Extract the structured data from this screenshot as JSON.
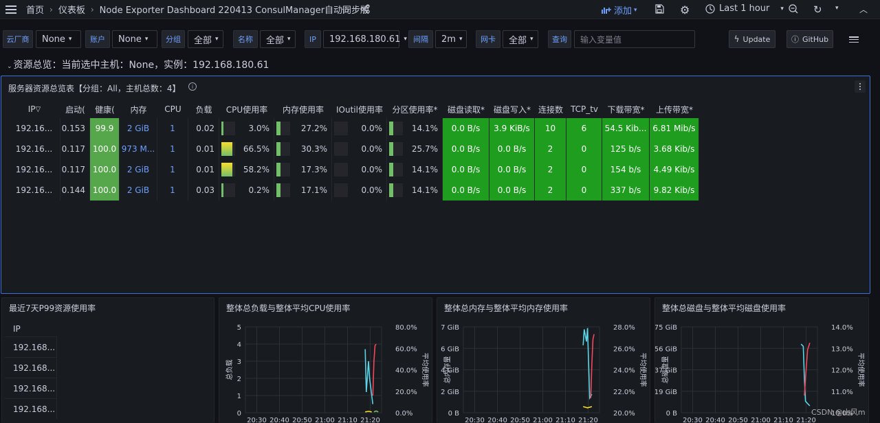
{
  "breadcrumb": {
    "home": "首页",
    "dashboards": "仪表板",
    "title": "Node Exporter Dashboard 220413 ConsulManager自动同步版"
  },
  "toolbar": {
    "add_label": "添加",
    "time_range": "Last 1 hour",
    "colors": {
      "add": "#6e9fff"
    }
  },
  "variables": {
    "cloud_label": "云厂商",
    "cloud_value": "None",
    "account_label": "账户",
    "account_value": "None",
    "group_label": "分组",
    "group_value": "全部",
    "name_label": "名称",
    "name_value": "全部",
    "ip_label": "IP",
    "ip_value": "192.168.180.61",
    "interval_label": "间隔",
    "interval_value": "2m",
    "nic_label": "网卡",
    "nic_value": "全部",
    "query_label": "查询",
    "query_placeholder": "输入变量值",
    "update_label": "Update",
    "github_label": "GitHub"
  },
  "row_title": "资源总览：当前选中主机：None，实例：192.168.180.61",
  "main_panel": {
    "title": "服务器资源总览表【分组：All，主机总数：4】",
    "columns": [
      "IP",
      "启动(",
      "健康(",
      "内存",
      "CPU",
      "负载",
      "CPU使用率",
      "内存使用率",
      "IOutil使用率",
      "分区使用率*",
      "磁盘读取*",
      "磁盘写入*",
      "连接数",
      "TCP_tv",
      "下载带宽*",
      "上传带宽*"
    ],
    "rows": [
      {
        "ip": "192.16...",
        "uptime": "0.153",
        "health": "99.9",
        "mem": "2 GiB",
        "cpu": "1",
        "load": "0.02",
        "cpu_pct": "3.0%",
        "cpu_level": 0.03,
        "mem_pct": "27.2%",
        "mem_level": 0.272,
        "io_pct": "0.0%",
        "io_level": 0.0,
        "part_pct": "14.1%",
        "part_level": 0.141,
        "disk_read": "0.0 B/s",
        "disk_write": "3.9 KiB/s",
        "conn": "10",
        "tcp_tw": "6",
        "down": "54.5 Kib...",
        "up": "6.81 Mib/s"
      },
      {
        "ip": "192.16...",
        "uptime": "0.117",
        "health": "100.0",
        "mem": "973 M...",
        "cpu": "1",
        "load": "0.01",
        "cpu_pct": "66.5%",
        "cpu_level": 0.665,
        "mem_pct": "30.3%",
        "mem_level": 0.303,
        "io_pct": "0.0%",
        "io_level": 0.0,
        "part_pct": "25.7%",
        "part_level": 0.257,
        "disk_read": "0.0 B/s",
        "disk_write": "0.0 B/s",
        "conn": "2",
        "tcp_tw": "0",
        "down": "125 b/s",
        "up": "3.68 Kib/s"
      },
      {
        "ip": "192.16...",
        "uptime": "0.117",
        "health": "100.0",
        "mem": "2 GiB",
        "cpu": "1",
        "load": "0.01",
        "cpu_pct": "58.2%",
        "cpu_level": 0.582,
        "mem_pct": "17.3%",
        "mem_level": 0.173,
        "io_pct": "0.0%",
        "io_level": 0.0,
        "part_pct": "14.1%",
        "part_level": 0.141,
        "disk_read": "0.0 B/s",
        "disk_write": "0.0 B/s",
        "conn": "2",
        "tcp_tw": "0",
        "down": "154 b/s",
        "up": "4.49 Kib/s"
      },
      {
        "ip": "192.16...",
        "uptime": "0.144",
        "health": "100.0",
        "mem": "2 GiB",
        "cpu": "1",
        "load": "0.03",
        "cpu_pct": "0.2%",
        "cpu_level": 0.002,
        "mem_pct": "17.1%",
        "mem_level": 0.171,
        "io_pct": "0.0%",
        "io_level": 0.0,
        "part_pct": "14.1%",
        "part_level": 0.141,
        "disk_read": "0.0 B/s",
        "disk_write": "0.0 B/s",
        "conn": "2",
        "tcp_tw": "0",
        "down": "337 b/s",
        "up": "9.82 Kib/s"
      }
    ]
  },
  "p99_panel": {
    "title": "最近7天P99资源使用率",
    "column": "IP",
    "rows": [
      "192.168...",
      "192.168...",
      "192.168...",
      "192.168..."
    ]
  },
  "chart_data": [
    {
      "type": "line",
      "title": "整体总负载与整体平均CPU使用率",
      "ylabel_left": "总负载",
      "ylabel_right": "平均使用率",
      "x_ticks": [
        "20:30",
        "20:40",
        "20:50",
        "21:00",
        "21:10",
        "21:20"
      ],
      "y_left_ticks": [
        "0",
        "1",
        "2",
        "3",
        "4",
        "5"
      ],
      "y_right_ticks": [
        "0.0%",
        "20.0%",
        "40.0%",
        "60.0%",
        "80.0%"
      ],
      "ylim_left": [
        0,
        5
      ],
      "ylim_right": [
        0,
        80
      ],
      "series": [
        {
          "color": "#73bf69",
          "x": [
            21.38,
            21.4,
            21.42
          ],
          "y": [
            0.05,
            0.1,
            0.05
          ]
        },
        {
          "color": "#5ad4e6",
          "x": [
            21.3,
            21.31,
            21.33,
            21.34,
            21.36,
            21.37
          ],
          "y": [
            3.7,
            1.2,
            3.0,
            2.0,
            1.0,
            0.5
          ]
        },
        {
          "color": "#f2495c",
          "x": [
            21.37,
            21.38,
            21.39,
            21.4
          ],
          "y": [
            1.0,
            3.0,
            3.9,
            4.0
          ]
        },
        {
          "color": "#fade2a",
          "x": [
            21.3,
            21.33,
            21.36
          ],
          "y": [
            0.05,
            0.08,
            0.05
          ]
        }
      ]
    },
    {
      "type": "line",
      "title": "整体总内存与整体平均内存使用率",
      "ylabel_left": "总内存量",
      "ylabel_right": "平均使用率",
      "x_ticks": [
        "20:30",
        "20:40",
        "20:50",
        "21:00",
        "21:10",
        "21:20"
      ],
      "y_left_ticks": [
        "0 B",
        "2 GiB",
        "4 GiB",
        "6 GiB",
        "7 GiB"
      ],
      "y_right_ticks": [
        "20.0%",
        "22.0%",
        "24.0%",
        "26.0%",
        "28.0%"
      ],
      "ylim_left": [
        0,
        7
      ],
      "ylim_right": [
        20,
        28
      ],
      "series": [
        {
          "color": "#5ad4e6",
          "x": [
            21.3,
            21.31,
            21.33,
            21.34,
            21.36,
            21.38
          ],
          "y": [
            5.5,
            6.8,
            5.8,
            6.9,
            1.2,
            1.5
          ]
        },
        {
          "color": "#f2495c",
          "x": [
            21.37,
            21.38,
            21.39,
            21.4
          ],
          "y": [
            1.2,
            4.0,
            6.0,
            6.4
          ]
        },
        {
          "color": "#fade2a",
          "x": [
            21.3,
            21.34,
            21.38
          ],
          "y": [
            0.5,
            0.4,
            0.5
          ]
        }
      ]
    },
    {
      "type": "line",
      "title": "整体总磁盘与整体平均磁盘使用率",
      "ylabel_left": "总磁盘量",
      "ylabel_right": "平均使用率",
      "x_ticks": [
        "20:30",
        "20:40",
        "20:50",
        "21:00",
        "21:10",
        "21:20"
      ],
      "y_left_ticks": [
        "0 B",
        "19 GiB",
        "37 GiB",
        "56 GiB",
        "75 GiB"
      ],
      "y_right_ticks": [
        "10.0%",
        "11.0%",
        "12.0%",
        "13.0%",
        "14.0%"
      ],
      "ylim_left": [
        0,
        75
      ],
      "ylim_right": [
        9.0,
        14.0
      ],
      "series": [
        {
          "color": "#5ad4e6",
          "x": [
            21.3,
            21.31,
            21.32,
            21.33,
            21.34,
            21.36,
            21.38
          ],
          "y": [
            60,
            59,
            58,
            30,
            10,
            8,
            6
          ]
        },
        {
          "color": "#f2495c",
          "x": [
            21.33,
            21.34,
            21.36,
            21.38
          ],
          "y": [
            15,
            30,
            55,
            61
          ]
        }
      ]
    }
  ],
  "watermark": "CSDN @山风m"
}
